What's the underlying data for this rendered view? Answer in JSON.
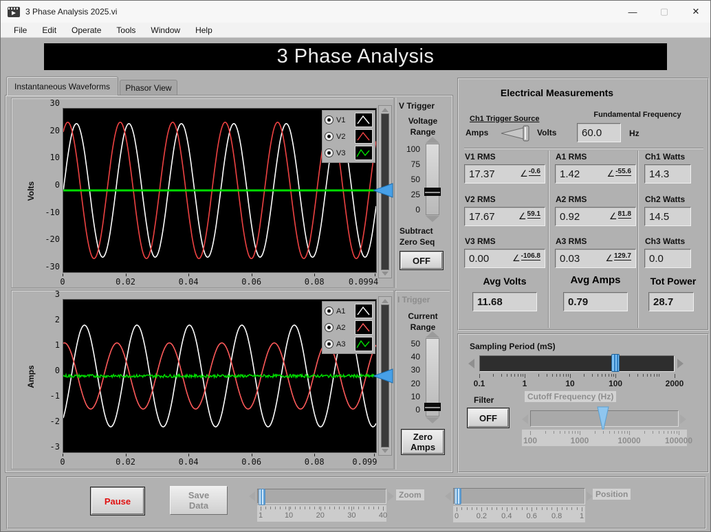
{
  "window": {
    "title": "3 Phase Analysis 2025.vi",
    "controls": {
      "minimize": "—",
      "maximize": "▢",
      "close": "✕"
    }
  },
  "menu": {
    "items": [
      "File",
      "Edit",
      "Operate",
      "Tools",
      "Window",
      "Help"
    ]
  },
  "banner": {
    "title": "3 Phase Analysis"
  },
  "tabs": {
    "active": "Instantaneous Waveforms",
    "inactive": "Phasor View"
  },
  "symbols": {
    "angle": "∠"
  },
  "colors": {
    "background": "#b1b1b1",
    "plot_bg": "#000000",
    "accent_blue": "#47a0e8",
    "pause_text": "#e01010"
  },
  "chart_data": [
    {
      "type": "line",
      "name": "volts-waveform-chart",
      "ylabel": "Volts",
      "ylim": [
        -30,
        30
      ],
      "y_ticks": [
        30,
        20,
        10,
        0,
        -10,
        -20,
        -30
      ],
      "xlim": [
        0,
        0.0994
      ],
      "x_ticks": [
        0,
        0.02,
        0.04,
        0.06,
        0.08,
        0.0994
      ],
      "x_tick_labels": [
        "0",
        "0.02",
        "0.04",
        "0.06",
        "0.08",
        "0.0994"
      ],
      "frequency_hz": 60,
      "grid": false,
      "legend_position": "top-right",
      "legend": [
        {
          "label": "V1"
        },
        {
          "label": "V2"
        },
        {
          "label": "V3"
        }
      ],
      "series": [
        {
          "name": "V1",
          "waveform": "sine",
          "amplitude": 24.5,
          "phase_deg": -0.6,
          "color": "#ffffff",
          "width": 1.6
        },
        {
          "name": "V2",
          "waveform": "sine",
          "amplitude": 25.0,
          "phase_deg": 59.1,
          "color": "#ee4242",
          "width": 1.6
        },
        {
          "name": "V3",
          "waveform": "flat",
          "value": 0,
          "color": "#00dd00",
          "width": 3
        }
      ],
      "trigger_level": 0
    },
    {
      "type": "line",
      "name": "amps-waveform-chart",
      "ylabel": "Amps",
      "ylim": [
        -3,
        3
      ],
      "y_ticks": [
        3,
        2,
        1,
        0,
        -1,
        -2,
        -3
      ],
      "xlim": [
        0,
        0.0994
      ],
      "x_ticks": [
        0,
        0.02,
        0.04,
        0.06,
        0.08,
        0.099
      ],
      "x_tick_labels": [
        "0",
        "0.02",
        "0.04",
        "0.06",
        "0.08",
        "0.099"
      ],
      "frequency_hz": 60,
      "grid": false,
      "legend_position": "top-right",
      "legend": [
        {
          "label": "A1"
        },
        {
          "label": "A2"
        },
        {
          "label": "A3"
        }
      ],
      "series": [
        {
          "name": "A1",
          "waveform": "sine",
          "amplitude": 2.0,
          "phase_deg": -55.6,
          "color": "#ffffff",
          "width": 1.6
        },
        {
          "name": "A2",
          "waveform": "sine",
          "amplitude": 1.3,
          "phase_deg": 81.8,
          "color": "#ff5a5a",
          "width": 1.6
        },
        {
          "name": "A3",
          "waveform": "noise",
          "amplitude": 0.06,
          "color": "#00dd00",
          "width": 1.5
        }
      ],
      "trigger_level": 0
    }
  ],
  "v_trigger": {
    "title": "V Trigger",
    "range_label_line1": "Voltage",
    "range_label_line2": "Range",
    "scale": [
      100,
      75,
      50,
      25,
      0
    ],
    "min": 0,
    "max": 100,
    "value": 30,
    "subtract_line1": "Subtract",
    "subtract_line2": "Zero Seq",
    "button_label": "OFF"
  },
  "i_trigger": {
    "title": "I Trigger",
    "range_label_line1": "Current",
    "range_label_line2": "Range",
    "scale": [
      50,
      40,
      30,
      20,
      10,
      0
    ],
    "min": 0,
    "max": 50,
    "value": 2,
    "button_line1": "Zero",
    "button_line2": "Amps"
  },
  "measurements": {
    "title": "Electrical Measurements",
    "trigger_source": {
      "label": "Ch1 Trigger Source",
      "option_left": "Amps",
      "option_right": "Volts",
      "selected": "Volts"
    },
    "frequency": {
      "label": "Fundamental Frequency",
      "value": "60.0",
      "unit": "Hz"
    },
    "columns": [
      {
        "rows": [
          {
            "label": "V1 RMS",
            "value": "17.37",
            "angle": "-0.6"
          },
          {
            "label": "V2 RMS",
            "value": "17.67",
            "angle": "59.1"
          },
          {
            "label": "V3 RMS",
            "value": "0.00",
            "angle": "-106.8"
          }
        ],
        "summary_label": "Avg Volts",
        "summary_value": "11.68"
      },
      {
        "rows": [
          {
            "label": "A1 RMS",
            "value": "1.42",
            "angle": "-55.6"
          },
          {
            "label": "A2 RMS",
            "value": "0.92",
            "angle": "81.8"
          },
          {
            "label": "A3 RMS",
            "value": "0.03",
            "angle": "129.7"
          }
        ],
        "summary_label": "Avg Amps",
        "summary_value": "0.79"
      },
      {
        "rows": [
          {
            "label": "Ch1 Watts",
            "value": "14.3"
          },
          {
            "label": "Ch2 Watts",
            "value": "14.5"
          },
          {
            "label": "Ch3 Watts",
            "value": "0.0"
          }
        ],
        "summary_label": "Tot Power",
        "summary_value": "28.7"
      }
    ]
  },
  "sampling": {
    "label": "Sampling Period (mS)",
    "value": 100,
    "scale": {
      "type": "log",
      "min": 0.1,
      "max": 2000,
      "labels": [
        0.1,
        1,
        10,
        100,
        2000
      ]
    }
  },
  "filter": {
    "label": "Filter",
    "button_label": "OFF"
  },
  "cutoff": {
    "label": "Cutoff Frequency (Hz)",
    "value": 3000,
    "disabled": true,
    "scale": {
      "type": "log",
      "min": 100,
      "max": 100000,
      "labels": [
        100,
        1000,
        10000,
        100000
      ]
    }
  },
  "footer": {
    "pause_label": "Pause",
    "save_line1": "Save",
    "save_line2": "Data",
    "zoom": {
      "label": "Zoom",
      "value": 1,
      "scale": {
        "type": "linear",
        "min": 1,
        "max": 40,
        "labels": [
          1,
          10,
          20,
          30,
          40
        ]
      }
    },
    "position": {
      "label": "Position",
      "value": 0,
      "scale": {
        "type": "linear",
        "min": 0,
        "max": 1,
        "labels": [
          0,
          0.2,
          0.4,
          0.6,
          0.8,
          1
        ]
      }
    }
  }
}
